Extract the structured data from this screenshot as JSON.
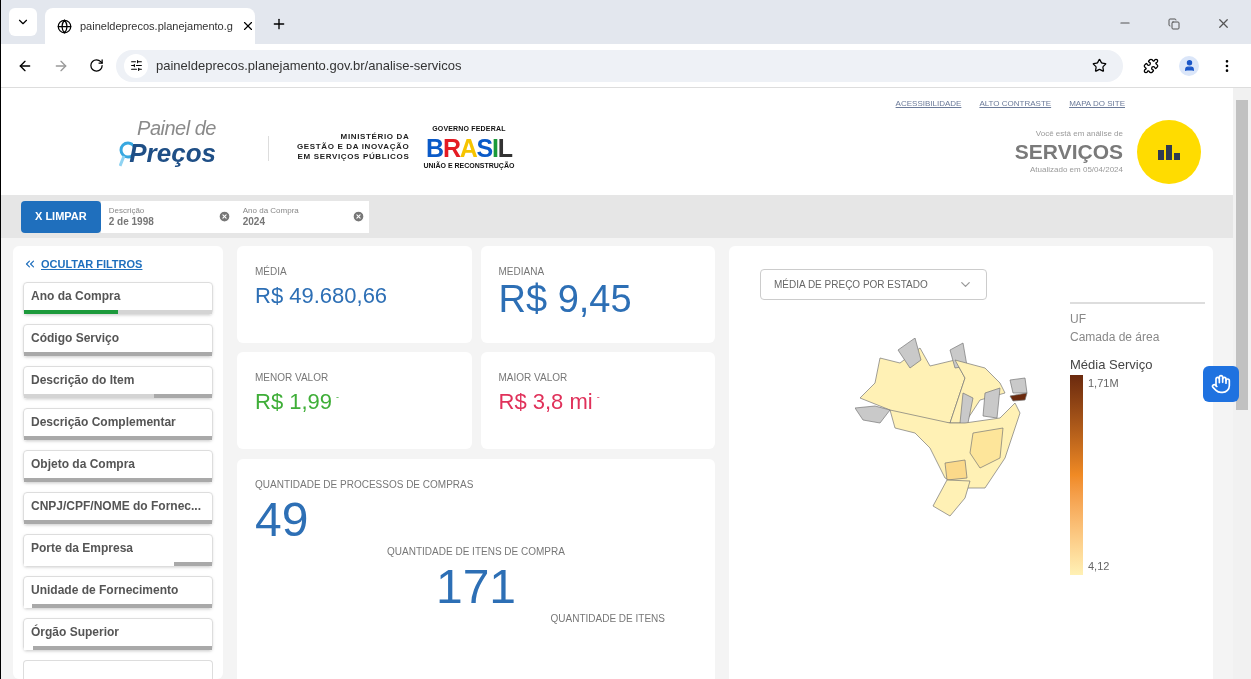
{
  "browser": {
    "tab_title": "paineldeprecos.planejamento.g",
    "url": "paineldeprecos.planejamento.gov.br/analise-servicos"
  },
  "header": {
    "logo_top": "Painel de",
    "logo_main": "Preços",
    "ministry": [
      "MINISTÉRIO DA",
      "GESTÃO E DA INOVAÇÃO",
      "EM SERVIÇOS PÚBLICOS"
    ],
    "gov_top": "GOVERNO FEDERAL",
    "gov_word": "BRASIL",
    "gov_bottom": "UNIÃO E RECONSTRUÇÃO",
    "links": [
      "ACESSIBILIDADE",
      "ALTO CONTRASTE",
      "MAPA DO SITE"
    ],
    "context_label": "Você está em análise de",
    "context_title": "SERVIÇOS",
    "updated": "Atualizado em 05/04/2024"
  },
  "selections": {
    "clear_button": "X LIMPAR",
    "items": [
      {
        "label": "Descrição",
        "value": "2 de 1998"
      },
      {
        "label": "Ano da Compra",
        "value": "2024"
      }
    ]
  },
  "filters": {
    "toggle": "OCULTAR FILTROS",
    "items": [
      {
        "label": "Ano da Compra",
        "bar": [
          {
            "kind": "selected",
            "level": 0.5
          },
          {
            "kind": "alternative",
            "level": 0.5
          }
        ]
      },
      {
        "label": "Código Serviço",
        "bar": [
          {
            "kind": "excluded",
            "level": 1
          }
        ]
      },
      {
        "label": "Descrição do Item",
        "bar": [
          {
            "kind": "alternative",
            "level": 0.69
          },
          {
            "kind": "excluded",
            "level": 0.31
          }
        ]
      },
      {
        "label": "Descrição Complementar",
        "bar": [
          {
            "kind": "excluded",
            "level": 1
          }
        ]
      },
      {
        "label": "Objeto da Compra",
        "bar": [
          {
            "kind": "excluded",
            "level": 1
          }
        ]
      },
      {
        "label": "CNPJ/CPF/NOME do Fornec...",
        "bar": [
          {
            "kind": "excluded",
            "level": 1
          }
        ]
      },
      {
        "label": "Porte da Empresa",
        "bar": [
          {
            "kind": "possible",
            "level": 0.8
          },
          {
            "kind": "excluded",
            "level": 0.2
          }
        ]
      },
      {
        "label": "Unidade de Fornecimento",
        "bar": [
          {
            "kind": "possible",
            "level": 0.04
          },
          {
            "kind": "excluded",
            "level": 0.96
          }
        ]
      },
      {
        "label": "Órgão Superior",
        "bar": [
          {
            "kind": "possible",
            "level": 0.05
          },
          {
            "kind": "excluded",
            "level": 0.95
          }
        ]
      }
    ]
  },
  "kpis": [
    {
      "label": "MÉDIA",
      "value": "R$ 49.680,66",
      "color": "#2d6fb5"
    },
    {
      "label": "MEDIANA",
      "value": "R$ 9,45",
      "color": "#2d6fb5"
    },
    {
      "label": "MENOR VALOR",
      "value": "R$ 1,99",
      "suffix": "-",
      "color": "#3fae38"
    },
    {
      "label": "MAIOR VALOR",
      "value": "R$ 3,8 mi",
      "suffix": "-",
      "color": "#e0315a"
    }
  ],
  "quantities": [
    {
      "label": "QUANTIDADE DE PROCESSOS DE COMPRAS",
      "value": "49"
    },
    {
      "label": "QUANTIDADE DE ITENS DE COMPRA",
      "value": "171"
    },
    {
      "label": "QUANTIDADE DE ITENS"
    }
  ],
  "map": {
    "dropdown": "MÉDIA DE PREÇO POR ESTADO",
    "legend": {
      "title": "UF",
      "layer": "Camada de área",
      "measure": "Média Serviço",
      "max": "1,71M",
      "min": "4,12"
    }
  }
}
